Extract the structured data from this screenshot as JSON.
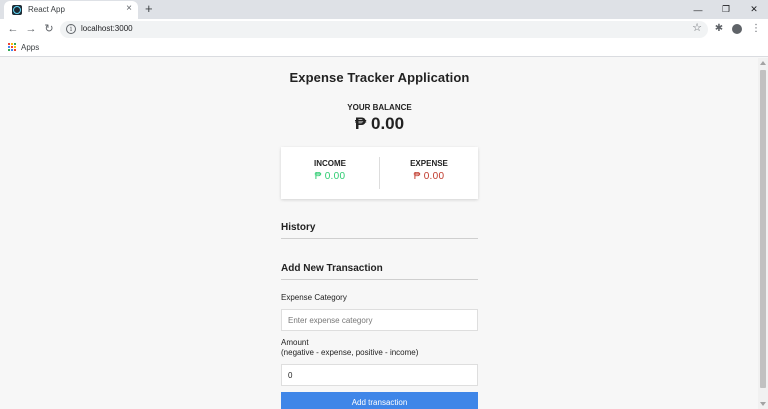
{
  "browser": {
    "tab_title": "React App",
    "tab_close": "×",
    "new_tab": "+",
    "window_minimize": "—",
    "window_restore": "❐",
    "window_close": "✕",
    "nav_back": "←",
    "nav_forward": "→",
    "nav_reload": "↻",
    "info_glyph": "i",
    "url": "localhost:3000",
    "star_glyph": "☆",
    "extensions_glyph": "✱",
    "menu_glyph": "⋮",
    "bookmarks_apps_label": "Apps",
    "apps_dot_colors": [
      "#ea4335",
      "#fbbc04",
      "#34a853",
      "#4285f4",
      "#ea4335",
      "#fbbc04",
      "#34a853",
      "#4285f4",
      "#ea4335"
    ]
  },
  "app": {
    "title": "Expense Tracker Application",
    "balance_label": "YOUR BALANCE",
    "balance_value": "₱ 0.00",
    "income_label": "INCOME",
    "income_value": "₱ 0.00",
    "expense_label": "EXPENSE",
    "expense_value": "₱ 0.00",
    "history_title": "History",
    "add_title": "Add New Transaction",
    "category_label": "Expense Category",
    "category_placeholder": "Enter expense category",
    "amount_label_line1": "Amount",
    "amount_label_line2": "(negative - expense, positive - income)",
    "amount_value": "0",
    "submit_label": "Add transaction"
  },
  "colors": {
    "income": "#2ecc71",
    "expense": "#c0392b",
    "button": "#3f86e8"
  }
}
